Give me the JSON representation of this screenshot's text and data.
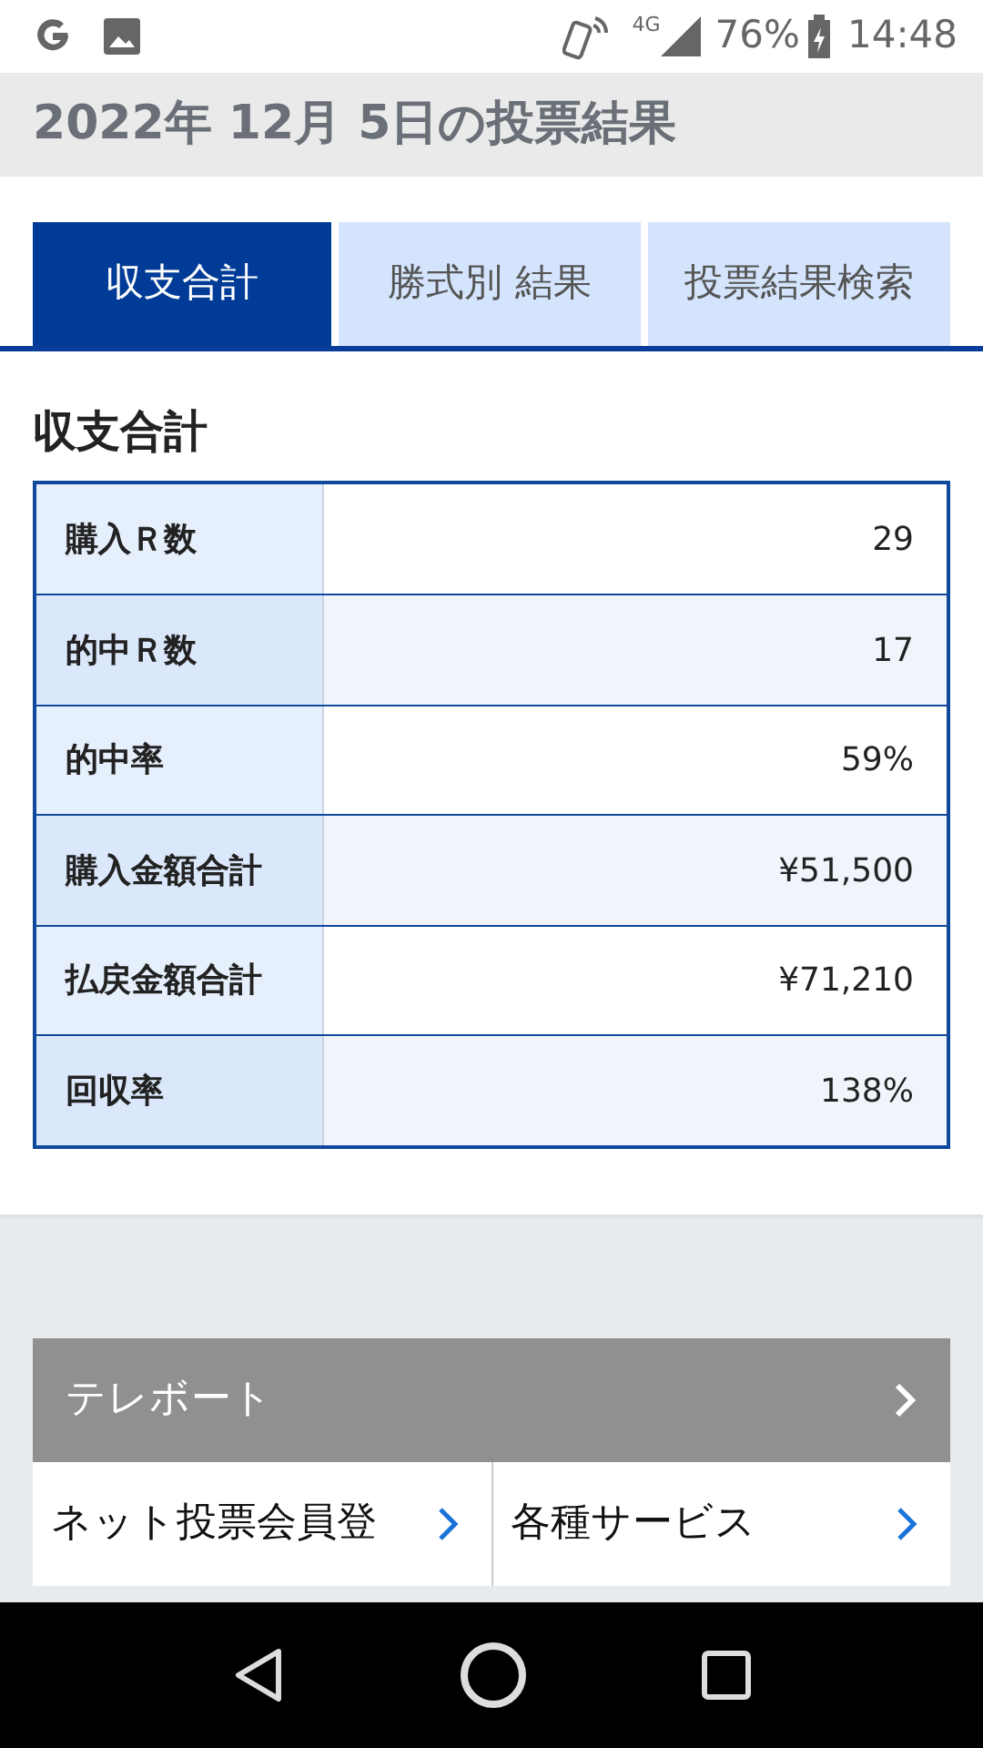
{
  "status_bar": {
    "battery": "76%",
    "time": "14:48",
    "network": "4G"
  },
  "page_title": "2022年 12月 5日の投票結果",
  "tabs": [
    {
      "label": "収支合計",
      "selected": true
    },
    {
      "label": "勝式別 結果",
      "selected": false
    },
    {
      "label": "投票結果検索",
      "selected": false
    }
  ],
  "section_title": "収支合計",
  "summary_rows": [
    {
      "label": "購入Ｒ数",
      "value": "29"
    },
    {
      "label": "的中Ｒ数",
      "value": "17"
    },
    {
      "label": "的中率",
      "value": "59%"
    },
    {
      "label": "購入金額合計",
      "value": "¥51,500"
    },
    {
      "label": "払戻金額合計",
      "value": "¥71,210"
    },
    {
      "label": "回収率",
      "value": "138%"
    }
  ],
  "teleport": {
    "label": "テレボート"
  },
  "links": [
    {
      "label": "ネット投票会員登"
    },
    {
      "label": "各種サービス"
    }
  ]
}
